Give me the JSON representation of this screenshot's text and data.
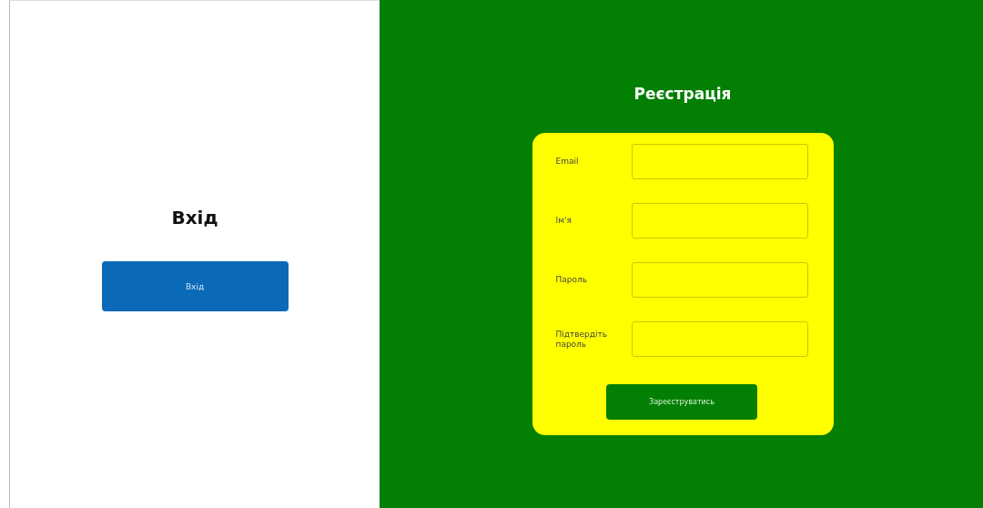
{
  "login": {
    "title": "Вхід",
    "button": "Вхід"
  },
  "register": {
    "title": "Реєстрація",
    "fields": [
      {
        "label": "Email"
      },
      {
        "label": "Ім'я"
      },
      {
        "label": "Пароль"
      },
      {
        "label": "Підтвердіть пароль"
      }
    ],
    "button": "Зареєструватись"
  }
}
